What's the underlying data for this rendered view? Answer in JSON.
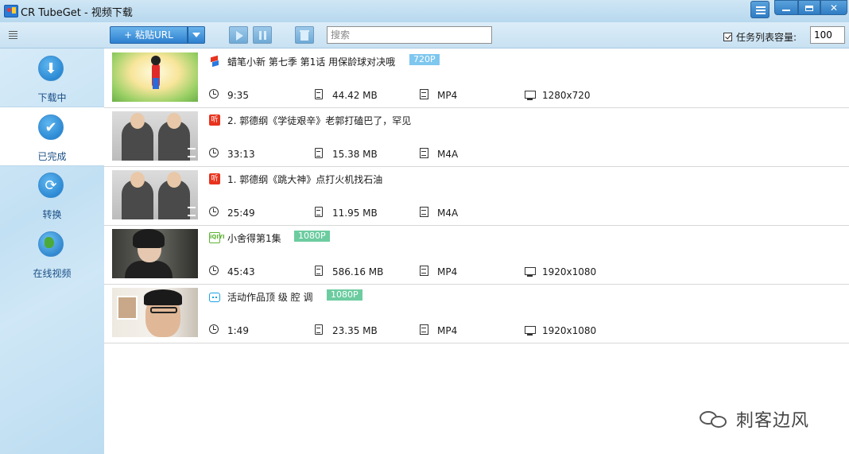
{
  "window": {
    "title": "CR TubeGet - 视频下载"
  },
  "toolbar": {
    "paste_label": "+ 粘贴URL",
    "search_placeholder": "搜索",
    "capacity_label": "任务列表容量:",
    "capacity_value": "100",
    "capacity_checked": true
  },
  "sidebar": {
    "items": [
      {
        "label": "下载中",
        "icon": "download-icon",
        "active": false
      },
      {
        "label": "已完成",
        "icon": "check-icon",
        "active": true
      },
      {
        "label": "转换",
        "icon": "convert-icon",
        "active": false
      },
      {
        "label": "在线视频",
        "icon": "globe-icon",
        "active": false
      }
    ]
  },
  "tasks": [
    {
      "title": "蜡笔小新 第七季 第1话 用保龄球对决哦",
      "badge": "720P",
      "badge_color": "#7ec7ef",
      "duration": "9:35",
      "size": "44.42 MB",
      "format": "MP4",
      "resolution": "1280x720",
      "source_icon": "source-flag-icon"
    },
    {
      "title": "2. 郭德纲《学徒艰辛》老郭打磕巴了，罕见",
      "badge": "",
      "duration": "33:13",
      "size": "15.38 MB",
      "format": "M4A",
      "resolution": "",
      "source_icon": "source-ting-icon"
    },
    {
      "title": "1. 郭德纲《跳大神》点打火机找石油",
      "badge": "",
      "duration": "25:49",
      "size": "11.95 MB",
      "format": "M4A",
      "resolution": "",
      "source_icon": "source-ting-icon"
    },
    {
      "title": "小舍得第1集",
      "badge": "1080P",
      "badge_color": "#6ccca0",
      "duration": "45:43",
      "size": "586.16 MB",
      "format": "MP4",
      "resolution": "1920x1080",
      "source_icon": "source-iqiyi-icon"
    },
    {
      "title": "活动作品顶 级 腔 调",
      "badge": "1080P",
      "badge_color": "#6ccca0",
      "duration": "1:49",
      "size": "23.35 MB",
      "format": "MP4",
      "resolution": "1920x1080",
      "source_icon": "source-bilibili-icon"
    }
  ],
  "source_icon_text": {
    "ting": "听",
    "iqiyi": "iQIYI"
  },
  "watermark": {
    "text": "刺客边风"
  }
}
